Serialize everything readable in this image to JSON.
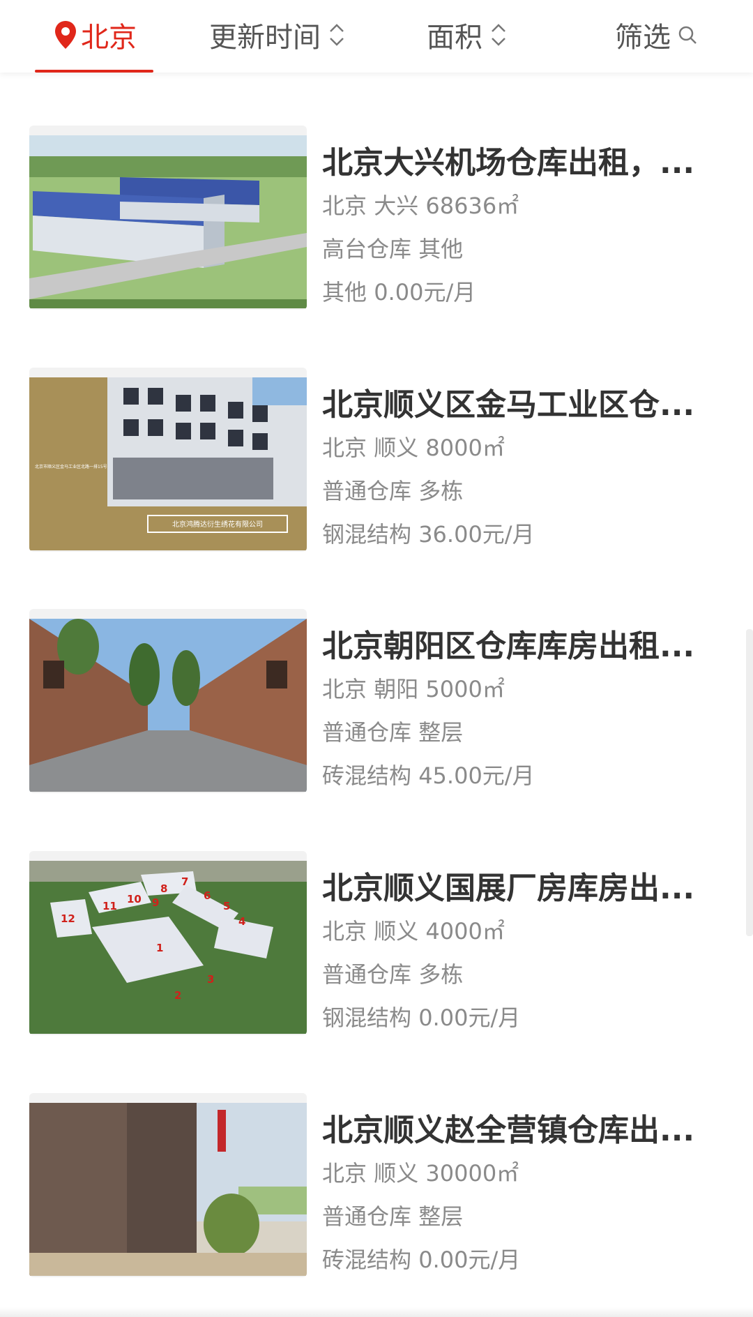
{
  "filter_bar": {
    "city": "北京",
    "sort_update": "更新时间",
    "sort_area": "面积",
    "filter": "筛选",
    "accent_color": "#e0271a"
  },
  "listings": [
    {
      "title": "北京大兴机场仓库出租，...",
      "location": "北京",
      "district": "大兴",
      "area": "68636㎡",
      "type": "高台仓库",
      "subtype": "其他",
      "structure": "其他",
      "price": "0.00元/月",
      "image": "warehouse-aerial-solar-roof"
    },
    {
      "title": "北京顺义区金马工业区仓...",
      "location": "北京",
      "district": "顺义",
      "area": "8000㎡",
      "type": "普通仓库",
      "subtype": "多栋",
      "structure": "钢混结构",
      "price": "36.00元/月",
      "image": "factory-building-with-signboard",
      "image_text": {
        "sign": "北京鸿腾达衍生绣花有限公司",
        "address": "北京市顺义区金马工业区北路一排15号"
      }
    },
    {
      "title": "北京朝阳区仓库库房出租...",
      "location": "北京",
      "district": "朝阳",
      "area": "5000㎡",
      "type": "普通仓库",
      "subtype": "整层",
      "structure": "砖混结构",
      "price": "45.00元/月",
      "image": "brick-warehouse-street"
    },
    {
      "title": "北京顺义国展厂房库房出...",
      "location": "北京",
      "district": "顺义",
      "area": "4000㎡",
      "type": "普通仓库",
      "subtype": "多栋",
      "structure": "钢混结构",
      "price": "0.00元/月",
      "image": "industrial-park-aerial-numbered",
      "image_text": {
        "numbers": [
          "1",
          "2",
          "3",
          "4",
          "5",
          "6",
          "7",
          "8",
          "9",
          "10",
          "11",
          "12"
        ]
      }
    },
    {
      "title": "北京顺义赵全营镇仓库出...",
      "location": "北京",
      "district": "顺义",
      "area": "30000㎡",
      "type": "普通仓库",
      "subtype": "整层",
      "structure": "砖混结构",
      "price": "0.00元/月",
      "image": "warehouse-entrance-trees"
    }
  ]
}
